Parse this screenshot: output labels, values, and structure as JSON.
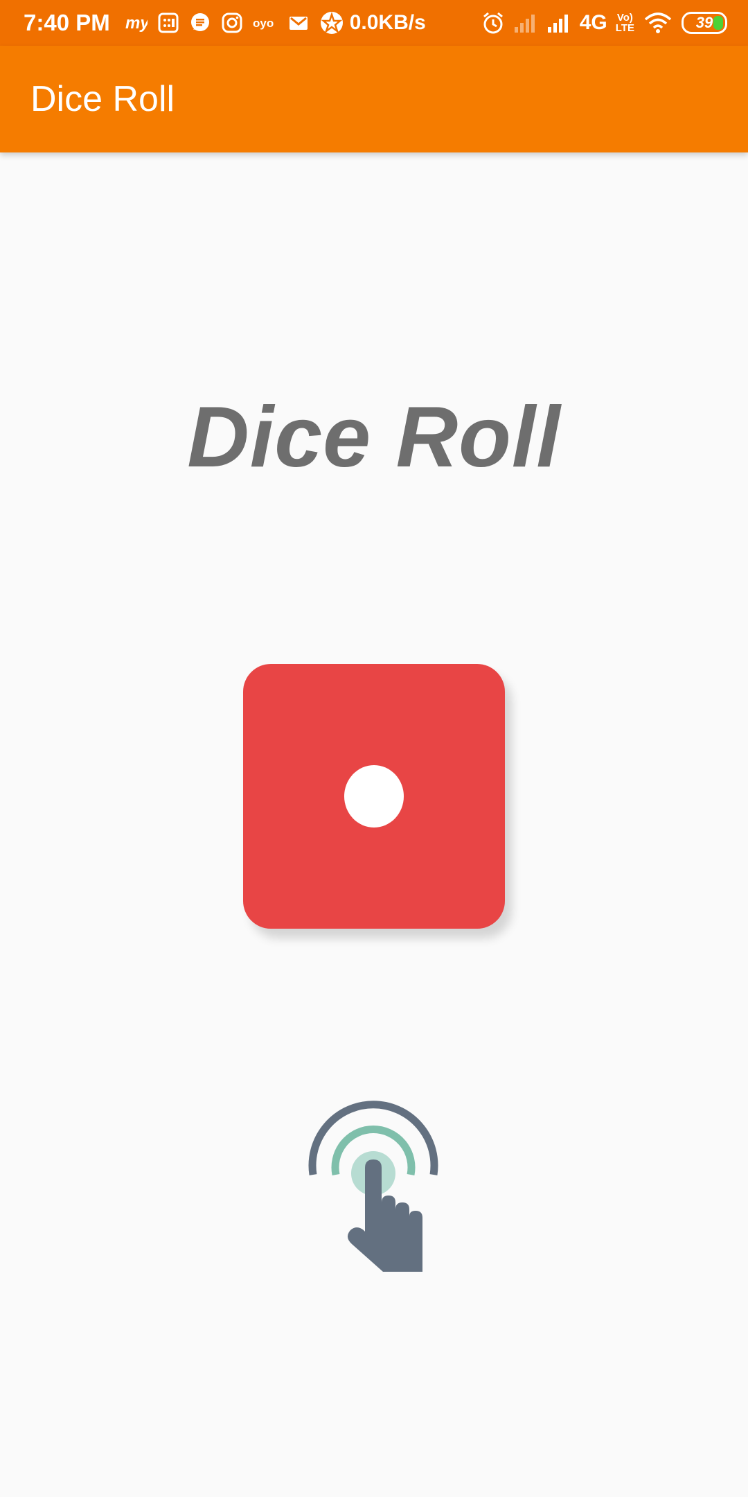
{
  "status_bar": {
    "time": "7:40 PM",
    "net_speed": "0.0KB/s",
    "network_type": "4G",
    "volte_top": "Vo)",
    "volte_bottom": "LTE",
    "battery_level": "39",
    "icons": [
      "myntra-icon",
      "calculator-icon",
      "messages-icon",
      "instagram-icon",
      "oyo-icon",
      "gmail-icon",
      "app-icon",
      "alarm-icon",
      "signal-icon",
      "wifi-icon",
      "battery-icon"
    ]
  },
  "app_bar": {
    "title": "Dice Roll",
    "background_color": "#f57c00"
  },
  "main": {
    "title": "Dice Roll",
    "dice": {
      "face_value": 1,
      "color": "#e84545"
    },
    "roll_icon": "tap-icon"
  }
}
